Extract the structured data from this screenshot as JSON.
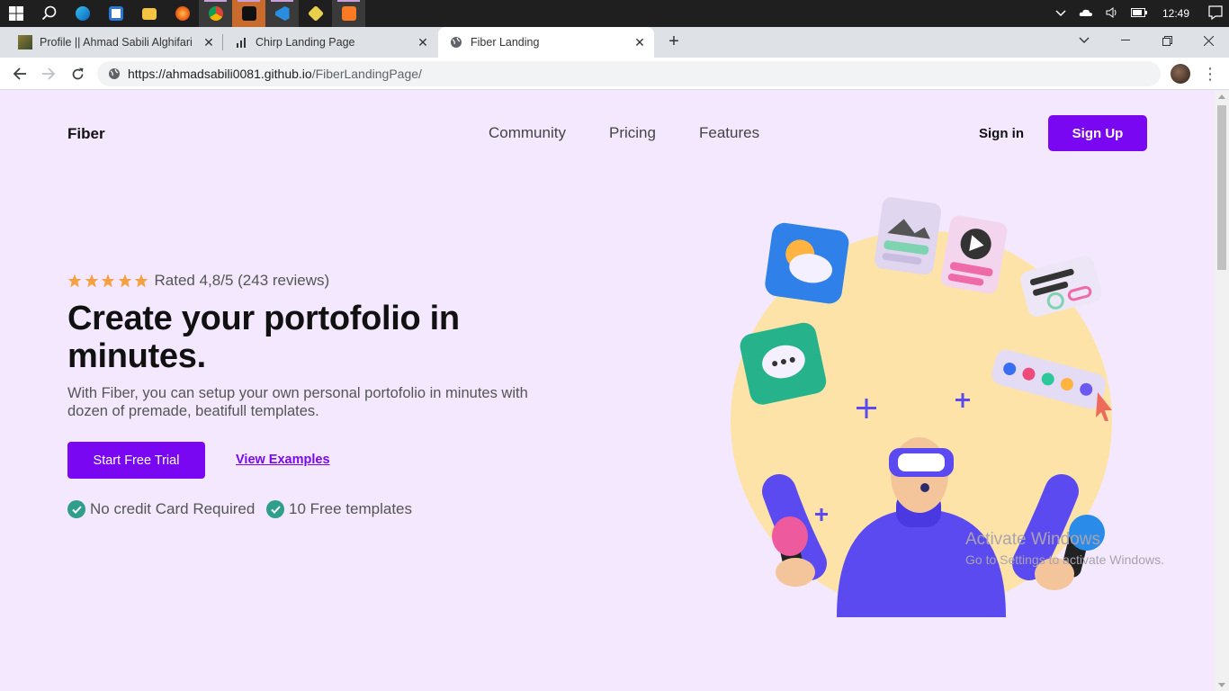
{
  "taskbar": {
    "clock": "12:49",
    "apps": [
      "search-icon",
      "edge-icon",
      "store-icon",
      "file-explorer-icon",
      "firefox-icon",
      "chrome-icon",
      "figma-icon",
      "vscode-icon",
      "git-icon",
      "xampp-icon"
    ]
  },
  "browser": {
    "tabs": [
      {
        "title": "Profile || Ahmad Sabili Alghifari",
        "active": false
      },
      {
        "title": "Chirp Landing Page",
        "active": false
      },
      {
        "title": "Fiber Landing",
        "active": true
      }
    ],
    "url_host": "https://ahmadsabili0081.github.io",
    "url_path": "/FiberLandingPage/"
  },
  "page": {
    "logo": "Fiber",
    "nav": [
      "Community",
      "Pricing",
      "Features"
    ],
    "signin": "Sign in",
    "signup": "Sign Up",
    "rating_text": "Rated 4,8/5 (243 reviews)",
    "stars": 5,
    "headline": "Create your portofolio in minutes.",
    "subtext": "With Fiber, you can setup your own personal portofolio in minutes with dozen of premade, beatifull templates.",
    "cta_primary": "Start Free Trial",
    "cta_secondary": "View Examples",
    "features": [
      "No credit Card Required",
      "10 Free templates"
    ],
    "colors": {
      "accent": "#7a07f2",
      "background": "#f3e8fd",
      "check": "#2f9e8a",
      "star": "#f5a142",
      "circle": "#fde3a7"
    }
  },
  "watermark": {
    "title": "Activate Windows",
    "subtitle": "Go to Settings to activate Windows."
  }
}
